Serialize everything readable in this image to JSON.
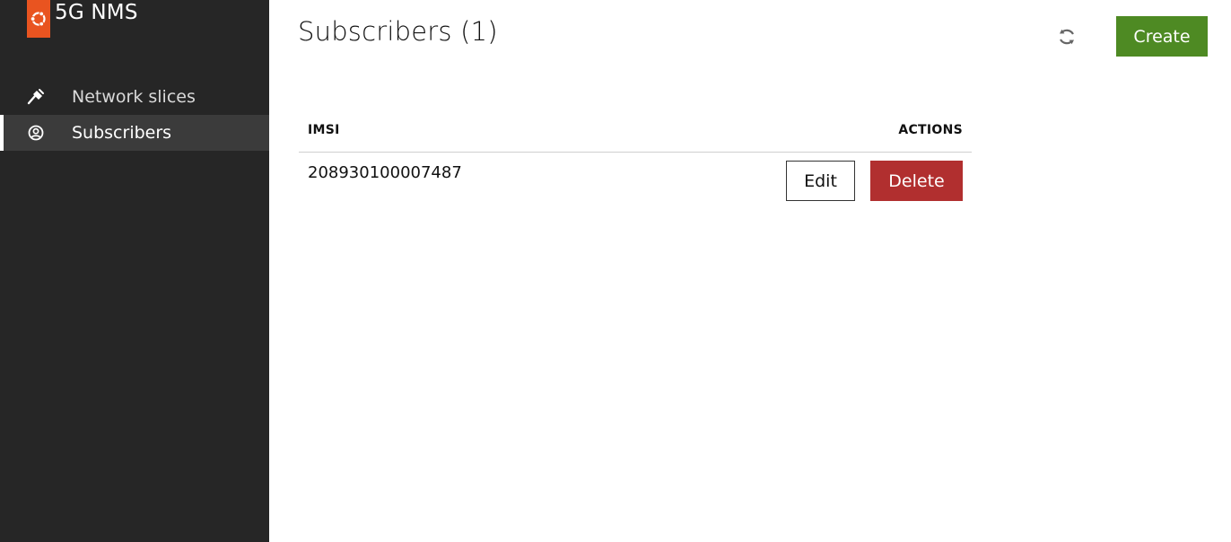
{
  "app": {
    "name": "5G NMS",
    "logo_icon": "ubuntu-logo-icon",
    "brand_color": "#e95420"
  },
  "sidebar": {
    "items": [
      {
        "label": "Network slices",
        "icon": "plug-icon",
        "active": false
      },
      {
        "label": "Subscribers",
        "icon": "user-circle-icon",
        "active": true
      }
    ]
  },
  "header": {
    "title": "Subscribers (1)",
    "refresh_icon": "refresh-icon",
    "create_label": "Create",
    "create_color": "#4e8a23"
  },
  "table": {
    "columns": [
      "IMSI",
      "ACTIONS"
    ],
    "rows": [
      {
        "imsi": "208930100007487",
        "edit_label": "Edit",
        "delete_label": "Delete"
      }
    ]
  },
  "colors": {
    "sidebar_bg": "#262626",
    "delete_button": "#b12f2f"
  }
}
